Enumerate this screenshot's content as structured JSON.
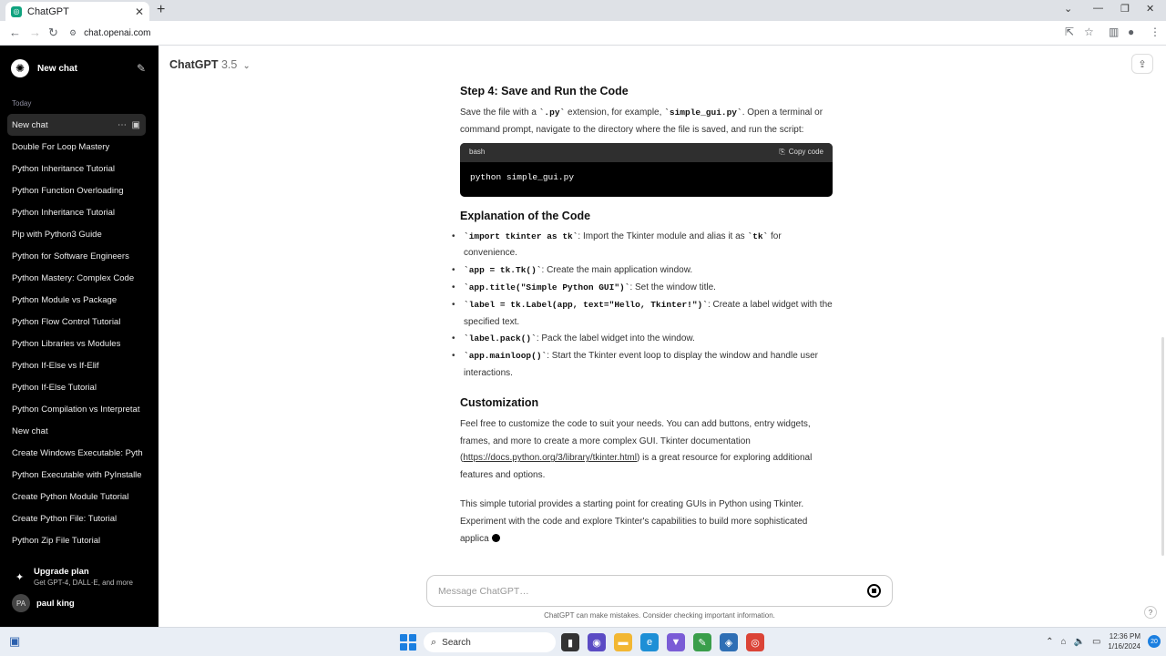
{
  "browser": {
    "tab_title": "ChatGPT",
    "url": "chat.openai.com"
  },
  "sidebar": {
    "new_chat": "New chat",
    "section_today": "Today",
    "items": [
      "New chat",
      "Double For Loop Mastery",
      "Python Inheritance Tutorial",
      "Python Function Overloading",
      "Python Inheritance Tutorial",
      "Pip with Python3 Guide",
      "Python for Software Engineers",
      "Python Mastery: Complex Code",
      "Python Module vs Package",
      "Python Flow Control Tutorial",
      "Python Libraries vs Modules",
      "Python If-Else vs If-Elif",
      "Python If-Else Tutorial",
      "Python Compilation vs Interpretat",
      "New chat",
      "Create Windows Executable: Pyth",
      "Python Executable with PyInstalle",
      "Create Python Module Tutorial",
      "Create Python File: Tutorial",
      "Python Zip File Tutorial"
    ],
    "upgrade_title": "Upgrade plan",
    "upgrade_sub": "Get GPT-4, DALL·E, and more",
    "user_initials": "PA",
    "user_name": "paul king"
  },
  "header": {
    "model": "ChatGPT",
    "version": "3.5"
  },
  "content": {
    "step4_heading": "Step 4: Save and Run the Code",
    "step4_p1": "Save the file with a ",
    "step4_code1": "`.py`",
    "step4_p2": " extension, for example, ",
    "step4_code2": "`simple_gui.py`",
    "step4_p3": ". Open a terminal or command prompt, navigate to the directory where the file is saved, and run the script:",
    "code_lang": "bash",
    "copy_label": "Copy code",
    "code_text": "python simple_gui.py",
    "explanation_heading": "Explanation of the Code",
    "bullets": [
      {
        "code": "`import tkinter as tk`",
        "pre": ": Import the Tkinter module and alias it as ",
        "code2": "`tk`",
        "post": " for convenience."
      },
      {
        "code": "`app = tk.Tk()`",
        "pre": ": Create the main application window.",
        "code2": "",
        "post": ""
      },
      {
        "code": "`app.title(\"Simple Python GUI\")`",
        "pre": ": Set the window title.",
        "code2": "",
        "post": ""
      },
      {
        "code": "`label = tk.Label(app, text=\"Hello, Tkinter!\")`",
        "pre": ": Create a label widget with the specified text.",
        "code2": "",
        "post": ""
      },
      {
        "code": "`label.pack()`",
        "pre": ": Pack the label widget into the window.",
        "code2": "",
        "post": ""
      },
      {
        "code": "`app.mainloop()`",
        "pre": ": Start the Tkinter event loop to display the window and handle user interactions.",
        "code2": "",
        "post": ""
      }
    ],
    "custom_heading": "Customization",
    "custom_p1": "Feel free to customize the code to suit your needs. You can add buttons, entry widgets, frames, and more to create a more complex GUI. Tkinter documentation (",
    "custom_link": "https://docs.python.org/3/library/tkinter.html",
    "custom_p2": ") is a great resource for exploring additional features and options.",
    "closing": "This simple tutorial provides a starting point for creating GUIs in Python using Tkinter. Experiment with the code and explore Tkinter's capabilities to build more sophisticated applica"
  },
  "composer": {
    "placeholder": "Message ChatGPT…",
    "disclaimer": "ChatGPT can make mistakes. Consider checking important information."
  },
  "taskbar": {
    "search": "Search",
    "time": "12:36 PM",
    "date": "1/16/2024",
    "notifications": "20"
  }
}
